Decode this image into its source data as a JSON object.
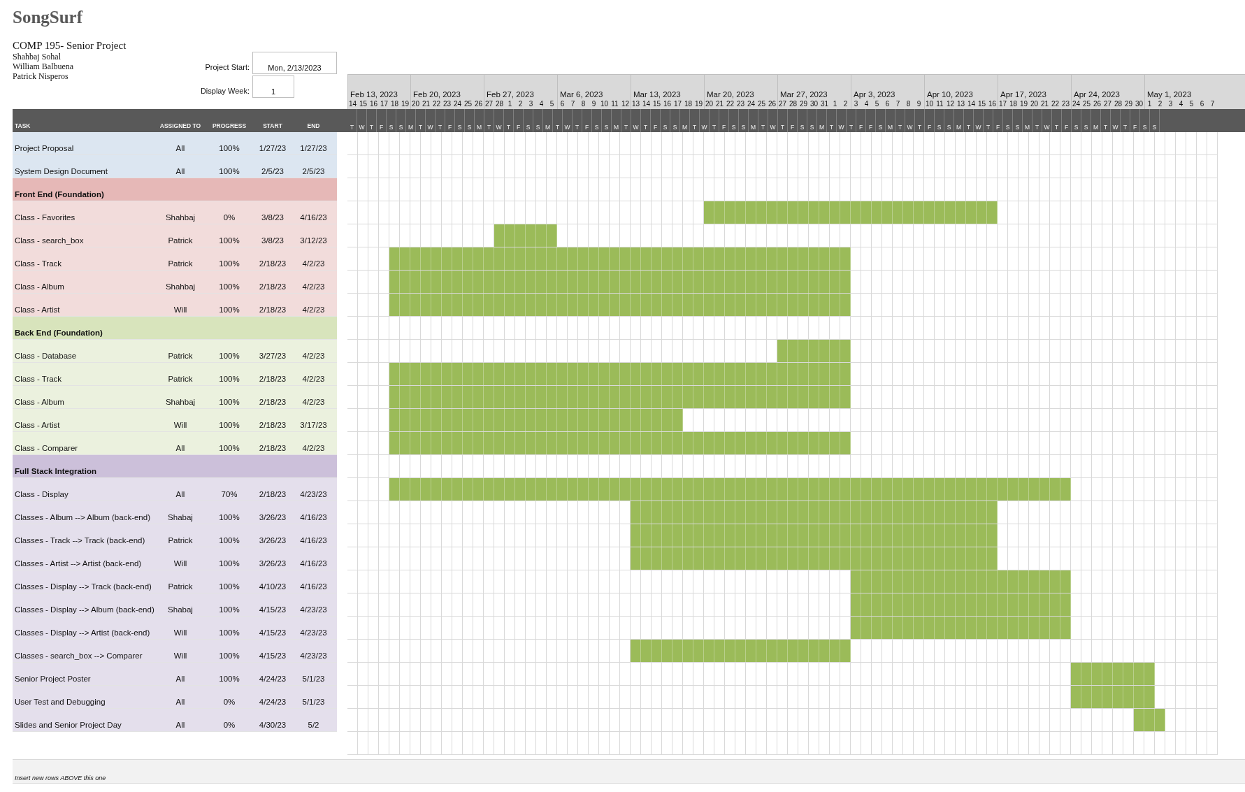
{
  "title": "SongSurf",
  "course": "COMP 195- Senior Project",
  "team": [
    "Shahbaj Sohal",
    "William Balbuena",
    "Patrick Nisperos"
  ],
  "project_start": {
    "label": "Project Start:",
    "value": "Mon, 2/13/2023"
  },
  "display_week": {
    "label": "Display Week:",
    "value": "1"
  },
  "columns": [
    "TASK",
    "ASSIGNED TO",
    "PROGRESS",
    "START",
    "END"
  ],
  "timeline": {
    "weeks": [
      {
        "label": "Feb 13, 2023",
        "days": [
          [
            "14",
            "T"
          ],
          [
            "15",
            "W"
          ],
          [
            "16",
            "T"
          ],
          [
            "17",
            "F"
          ],
          [
            "18",
            "S"
          ],
          [
            "19",
            "S"
          ]
        ]
      },
      {
        "label": "Feb 20, 2023",
        "days": [
          [
            "20",
            "M"
          ],
          [
            "21",
            "T"
          ],
          [
            "22",
            "W"
          ],
          [
            "23",
            "T"
          ],
          [
            "24",
            "F"
          ],
          [
            "25",
            "S"
          ],
          [
            "26",
            "S"
          ]
        ]
      },
      {
        "label": "Feb 27, 2023",
        "days": [
          [
            "27",
            "M"
          ],
          [
            "28",
            "T"
          ],
          [
            "1",
            "W"
          ],
          [
            "2",
            "T"
          ],
          [
            "3",
            "F"
          ],
          [
            "4",
            "S"
          ],
          [
            "5",
            "S"
          ]
        ]
      },
      {
        "label": "Mar 6, 2023",
        "days": [
          [
            "6",
            "M"
          ],
          [
            "7",
            "T"
          ],
          [
            "8",
            "W"
          ],
          [
            "9",
            "T"
          ],
          [
            "10",
            "F"
          ],
          [
            "11",
            "S"
          ],
          [
            "12",
            "S"
          ]
        ]
      },
      {
        "label": "Mar 13, 2023",
        "days": [
          [
            "13",
            "M"
          ],
          [
            "14",
            "T"
          ],
          [
            "15",
            "W"
          ],
          [
            "16",
            "T"
          ],
          [
            "17",
            "F"
          ],
          [
            "18",
            "S"
          ],
          [
            "19",
            "S"
          ]
        ]
      },
      {
        "label": "Mar 20, 2023",
        "days": [
          [
            "20",
            "M"
          ],
          [
            "21",
            "T"
          ],
          [
            "22",
            "W"
          ],
          [
            "23",
            "T"
          ],
          [
            "24",
            "F"
          ],
          [
            "25",
            "S"
          ],
          [
            "26",
            "S"
          ]
        ]
      },
      {
        "label": "Mar 27, 2023",
        "days": [
          [
            "27",
            "M"
          ],
          [
            "28",
            "T"
          ],
          [
            "29",
            "W"
          ],
          [
            "30",
            "T"
          ],
          [
            "31",
            "F"
          ],
          [
            "1",
            "S"
          ],
          [
            "2",
            "S"
          ]
        ]
      },
      {
        "label": "Apr 3, 2023",
        "days": [
          [
            "3",
            "M"
          ],
          [
            "4",
            "T"
          ],
          [
            "5",
            "W"
          ],
          [
            "6",
            "T"
          ],
          [
            "7",
            "F"
          ],
          [
            "8",
            "F"
          ],
          [
            "9",
            "S"
          ]
        ]
      },
      {
        "label": "Apr 10, 2023",
        "days": [
          [
            "10",
            "M"
          ],
          [
            "11",
            "T"
          ],
          [
            "12",
            "W"
          ],
          [
            "13",
            "T"
          ],
          [
            "14",
            "F"
          ],
          [
            "15",
            "S"
          ],
          [
            "16",
            "S"
          ]
        ]
      },
      {
        "label": "Apr 17, 2023",
        "days": [
          [
            "17",
            "M"
          ],
          [
            "18",
            "T"
          ],
          [
            "19",
            "W"
          ],
          [
            "20",
            "T"
          ],
          [
            "21",
            "F"
          ],
          [
            "22",
            "S"
          ],
          [
            "23",
            "S"
          ]
        ]
      },
      {
        "label": "Apr 24, 2023",
        "days": [
          [
            "24",
            "M"
          ],
          [
            "25",
            "T"
          ],
          [
            "26",
            "W"
          ],
          [
            "27",
            "T"
          ],
          [
            "28",
            "F"
          ],
          [
            "29",
            "S"
          ],
          [
            "30",
            "S"
          ]
        ]
      },
      {
        "label": "May 1, 2023",
        "days": [
          [
            "1",
            "M"
          ],
          [
            "2",
            "T"
          ],
          [
            "3",
            "W"
          ],
          [
            "4",
            "T"
          ],
          [
            "5",
            "F"
          ],
          [
            "6",
            "S"
          ],
          [
            "7",
            "S"
          ]
        ]
      }
    ]
  },
  "rows": [
    {
      "kind": "task",
      "color": "#dce6f1",
      "task": "Project Proposal",
      "assigned": "All",
      "progress": "100%",
      "start": "1/27/23",
      "end": "1/27/23"
    },
    {
      "kind": "task",
      "color": "#dce6f1",
      "task": "System Design Document",
      "assigned": "All",
      "progress": "100%",
      "start": "2/5/23",
      "end": "2/5/23"
    },
    {
      "kind": "section",
      "color": "#e6b8b7",
      "task": "Front End (Foundation)"
    },
    {
      "kind": "task",
      "color": "#f2dcdb",
      "task": "Class - Favorites",
      "assigned": "Shahbaj",
      "progress": "0%",
      "start": "3/8/23",
      "end": "4/16/23",
      "cells": [
        false,
        false,
        false,
        false,
        false,
        false,
        false,
        false,
        false,
        false,
        false,
        false,
        false,
        false,
        false,
        false,
        false,
        false,
        false,
        false,
        false,
        false,
        false,
        false,
        false,
        false,
        false,
        false,
        false,
        false,
        false,
        false,
        false,
        false,
        true,
        true,
        true,
        true,
        true,
        true,
        true,
        true,
        true,
        true,
        true,
        true,
        true,
        true,
        true,
        true,
        true,
        true,
        true,
        true,
        true,
        true,
        true,
        true,
        true,
        true,
        true,
        true,
        false,
        false,
        false,
        false,
        false,
        false,
        false,
        false,
        false,
        false,
        false,
        false,
        false,
        false,
        false,
        false,
        false,
        false,
        false,
        false,
        false
      ]
    },
    {
      "kind": "task",
      "color": "#f2dcdb",
      "task": "Class - search_box",
      "assigned": "Patrick",
      "progress": "100%",
      "start": "3/8/23",
      "end": "3/12/23",
      "cells": [
        false,
        false,
        false,
        false,
        false,
        false,
        false,
        false,
        false,
        false,
        false,
        false,
        false,
        false,
        true,
        true,
        true,
        true,
        true,
        true,
        false,
        false,
        false,
        false,
        false,
        false,
        false,
        false,
        false,
        false,
        false,
        false,
        false,
        false,
        false,
        false,
        false,
        false,
        false,
        false,
        false,
        false,
        false,
        false,
        false,
        false,
        false,
        false,
        false,
        false,
        false,
        false,
        false,
        false,
        false,
        false,
        false,
        false,
        false,
        false,
        false,
        false,
        false,
        false,
        false,
        false,
        false,
        false,
        false,
        false,
        false,
        false,
        false,
        false,
        false,
        false,
        false,
        false,
        false,
        false,
        false,
        false,
        false
      ]
    },
    {
      "kind": "task",
      "color": "#f2dcdb",
      "task": "Class - Track",
      "assigned": "Patrick",
      "progress": "100%",
      "start": "2/18/23",
      "end": "4/2/23",
      "cells": [
        false,
        false,
        false,
        false,
        true,
        true,
        true,
        true,
        true,
        true,
        true,
        true,
        true,
        true,
        true,
        true,
        true,
        true,
        true,
        true,
        true,
        true,
        true,
        true,
        true,
        true,
        true,
        true,
        true,
        true,
        true,
        true,
        true,
        true,
        true,
        true,
        true,
        true,
        true,
        true,
        true,
        true,
        true,
        true,
        true,
        true,
        true,
        true,
        false,
        false,
        false,
        false,
        false,
        false,
        false,
        false,
        false,
        false,
        false,
        false,
        false,
        false,
        false,
        false,
        false,
        false,
        false,
        false,
        false,
        false,
        false,
        false,
        false,
        false,
        false,
        false,
        false,
        false,
        false,
        false,
        false,
        false,
        false
      ]
    },
    {
      "kind": "task",
      "color": "#f2dcdb",
      "task": "Class - Album",
      "assigned": "Shahbaj",
      "progress": "100%",
      "start": "2/18/23",
      "end": "4/2/23",
      "cells": [
        false,
        false,
        false,
        false,
        true,
        true,
        true,
        true,
        true,
        true,
        true,
        true,
        true,
        true,
        true,
        true,
        true,
        true,
        true,
        true,
        true,
        true,
        true,
        true,
        true,
        true,
        true,
        true,
        true,
        true,
        true,
        true,
        true,
        true,
        true,
        true,
        true,
        true,
        true,
        true,
        true,
        true,
        true,
        true,
        true,
        true,
        true,
        true,
        false,
        false,
        false,
        false,
        false,
        false,
        false,
        false,
        false,
        false,
        false,
        false,
        false,
        false,
        false,
        false,
        false,
        false,
        false,
        false,
        false,
        false,
        false,
        false,
        false,
        false,
        false,
        false,
        false,
        false,
        false,
        false,
        false,
        false,
        false
      ]
    },
    {
      "kind": "task",
      "color": "#f2dcdb",
      "task": "Class - Artist",
      "assigned": "Will",
      "progress": "100%",
      "start": "2/18/23",
      "end": "4/2/23",
      "cells": [
        false,
        false,
        false,
        false,
        true,
        true,
        true,
        true,
        true,
        true,
        true,
        true,
        true,
        true,
        true,
        true,
        true,
        true,
        true,
        true,
        true,
        true,
        true,
        true,
        true,
        true,
        true,
        true,
        true,
        true,
        true,
        true,
        true,
        true,
        true,
        true,
        true,
        true,
        true,
        true,
        true,
        true,
        true,
        true,
        true,
        true,
        true,
        true,
        false,
        false,
        false,
        false,
        false,
        false,
        false,
        false,
        false,
        false,
        false,
        false,
        false,
        false,
        false,
        false,
        false,
        false,
        false,
        false,
        false,
        false,
        false,
        false,
        false,
        false,
        false,
        false,
        false,
        false,
        false,
        false,
        false,
        false,
        false
      ]
    },
    {
      "kind": "section",
      "color": "#d8e4bc",
      "task": "Back End (Foundation)"
    },
    {
      "kind": "task",
      "color": "#ebf1de",
      "task": "Class - Database",
      "assigned": "Patrick",
      "progress": "100%",
      "start": "3/27/23",
      "end": "4/2/23",
      "cells": [
        false,
        false,
        false,
        false,
        false,
        false,
        false,
        false,
        false,
        false,
        false,
        false,
        false,
        false,
        false,
        false,
        false,
        false,
        false,
        false,
        false,
        false,
        false,
        false,
        false,
        false,
        false,
        false,
        false,
        false,
        false,
        false,
        false,
        false,
        false,
        false,
        false,
        false,
        false,
        false,
        false,
        true,
        true,
        true,
        true,
        true,
        true,
        true,
        false,
        false,
        false,
        false,
        false,
        false,
        false,
        false,
        false,
        false,
        false,
        false,
        false,
        false,
        false,
        false,
        false,
        false,
        false,
        false,
        false,
        false,
        false,
        false,
        false,
        false,
        false,
        false,
        false,
        false,
        false,
        false,
        false,
        false,
        false
      ]
    },
    {
      "kind": "task",
      "color": "#ebf1de",
      "task": "Class - Track",
      "assigned": "Patrick",
      "progress": "100%",
      "start": "2/18/23",
      "end": "4/2/23",
      "cells": [
        false,
        false,
        false,
        false,
        true,
        true,
        true,
        true,
        true,
        true,
        true,
        true,
        true,
        true,
        true,
        true,
        true,
        true,
        true,
        true,
        true,
        true,
        true,
        true,
        true,
        true,
        true,
        true,
        true,
        true,
        true,
        true,
        true,
        true,
        true,
        true,
        true,
        true,
        true,
        true,
        true,
        true,
        true,
        true,
        true,
        true,
        true,
        true,
        false,
        false,
        false,
        false,
        false,
        false,
        false,
        false,
        false,
        false,
        false,
        false,
        false,
        false,
        false,
        false,
        false,
        false,
        false,
        false,
        false,
        false,
        false,
        false,
        false,
        false,
        false,
        false,
        false,
        false,
        false,
        false,
        false,
        false,
        false
      ]
    },
    {
      "kind": "task",
      "color": "#ebf1de",
      "task": "Class - Album",
      "assigned": "Shahbaj",
      "progress": "100%",
      "start": "2/18/23",
      "end": "4/2/23",
      "cells": [
        false,
        false,
        false,
        false,
        true,
        true,
        true,
        true,
        true,
        true,
        true,
        true,
        true,
        true,
        true,
        true,
        true,
        true,
        true,
        true,
        true,
        true,
        true,
        true,
        true,
        true,
        true,
        true,
        true,
        true,
        true,
        true,
        true,
        true,
        true,
        true,
        true,
        true,
        true,
        true,
        true,
        true,
        true,
        true,
        true,
        true,
        true,
        true,
        false,
        false,
        false,
        false,
        false,
        false,
        false,
        false,
        false,
        false,
        false,
        false,
        false,
        false,
        false,
        false,
        false,
        false,
        false,
        false,
        false,
        false,
        false,
        false,
        false,
        false,
        false,
        false,
        false,
        false,
        false,
        false,
        false,
        false,
        false
      ]
    },
    {
      "kind": "task",
      "color": "#ebf1de",
      "task": "Class - Artist",
      "assigned": "Will",
      "progress": "100%",
      "start": "2/18/23",
      "end": "3/17/23",
      "cells": [
        false,
        false,
        false,
        false,
        true,
        true,
        true,
        true,
        true,
        true,
        true,
        true,
        true,
        true,
        true,
        true,
        true,
        true,
        true,
        true,
        true,
        true,
        true,
        true,
        true,
        true,
        true,
        true,
        true,
        true,
        true,
        true,
        false,
        false,
        false,
        false,
        false,
        false,
        false,
        false,
        false,
        false,
        false,
        false,
        false,
        false,
        false,
        false,
        false,
        false,
        false,
        false,
        false,
        false,
        false,
        false,
        false,
        false,
        false,
        false,
        false,
        false,
        false,
        false,
        false,
        false,
        false,
        false,
        false,
        false,
        false,
        false,
        false,
        false,
        false,
        false,
        false,
        false,
        false,
        false,
        false,
        false,
        false
      ]
    },
    {
      "kind": "task",
      "color": "#ebf1de",
      "task": "Class - Comparer",
      "assigned": "All",
      "progress": "100%",
      "start": "2/18/23",
      "end": "4/2/23",
      "cells": [
        false,
        false,
        false,
        false,
        true,
        true,
        true,
        true,
        true,
        true,
        true,
        true,
        true,
        true,
        true,
        true,
        true,
        true,
        true,
        true,
        true,
        true,
        true,
        true,
        true,
        true,
        true,
        true,
        true,
        true,
        true,
        true,
        true,
        true,
        true,
        true,
        true,
        true,
        true,
        true,
        true,
        true,
        true,
        true,
        true,
        true,
        true,
        true,
        false,
        false,
        false,
        false,
        false,
        false,
        false,
        false,
        false,
        false,
        false,
        false,
        false,
        false,
        false,
        false,
        false,
        false,
        false,
        false,
        false,
        false,
        false,
        false,
        false,
        false,
        false,
        false,
        false,
        false,
        false,
        false,
        false,
        false,
        false
      ]
    },
    {
      "kind": "section",
      "color": "#ccc0da",
      "task": "Full Stack Integration"
    },
    {
      "kind": "task",
      "color": "#e4dfec",
      "task": "Class - Display",
      "assigned": "All",
      "progress": "70%",
      "start": "2/18/23",
      "end": "4/23/23",
      "cells": [
        false,
        false,
        false,
        false,
        true,
        true,
        true,
        true,
        true,
        true,
        true,
        true,
        true,
        true,
        true,
        true,
        true,
        true,
        true,
        true,
        true,
        true,
        true,
        true,
        true,
        true,
        true,
        true,
        true,
        true,
        true,
        true,
        true,
        true,
        true,
        true,
        true,
        true,
        true,
        true,
        true,
        true,
        true,
        true,
        true,
        true,
        true,
        true,
        true,
        true,
        true,
        true,
        true,
        true,
        true,
        true,
        true,
        true,
        true,
        true,
        true,
        true,
        true,
        true,
        true,
        true,
        true,
        true,
        true,
        false,
        false,
        false,
        false,
        false,
        false,
        false,
        false,
        false,
        false,
        false,
        false,
        false,
        false
      ]
    },
    {
      "kind": "task",
      "color": "#e4dfec",
      "task": "Classes - Album --> Album (back-end)",
      "assigned": "Shabaj",
      "progress": "100%",
      "start": "3/26/23",
      "end": "4/16/23",
      "cells": [
        false,
        false,
        false,
        false,
        false,
        false,
        false,
        false,
        false,
        false,
        false,
        false,
        false,
        false,
        false,
        false,
        false,
        false,
        false,
        false,
        false,
        false,
        false,
        false,
        false,
        false,
        false,
        true,
        true,
        true,
        true,
        true,
        true,
        true,
        true,
        true,
        true,
        true,
        true,
        true,
        true,
        true,
        true,
        true,
        true,
        true,
        true,
        true,
        true,
        true,
        true,
        true,
        true,
        true,
        true,
        true,
        true,
        true,
        true,
        true,
        true,
        true,
        false,
        false,
        false,
        false,
        false,
        false,
        false,
        false,
        false,
        false,
        false,
        false,
        false,
        false,
        false,
        false,
        false,
        false,
        false,
        false,
        false
      ]
    },
    {
      "kind": "task",
      "color": "#e4dfec",
      "task": "Classes - Track --> Track (back-end)",
      "assigned": "Patrick",
      "progress": "100%",
      "start": "3/26/23",
      "end": "4/16/23",
      "cells": [
        false,
        false,
        false,
        false,
        false,
        false,
        false,
        false,
        false,
        false,
        false,
        false,
        false,
        false,
        false,
        false,
        false,
        false,
        false,
        false,
        false,
        false,
        false,
        false,
        false,
        false,
        false,
        true,
        true,
        true,
        true,
        true,
        true,
        true,
        true,
        true,
        true,
        true,
        true,
        true,
        true,
        true,
        true,
        true,
        true,
        true,
        true,
        true,
        true,
        true,
        true,
        true,
        true,
        true,
        true,
        true,
        true,
        true,
        true,
        true,
        true,
        true,
        false,
        false,
        false,
        false,
        false,
        false,
        false,
        false,
        false,
        false,
        false,
        false,
        false,
        false,
        false,
        false,
        false,
        false,
        false,
        false,
        false
      ]
    },
    {
      "kind": "task",
      "color": "#e4dfec",
      "task": "Classes - Artist --> Artist (back-end)",
      "assigned": "Will",
      "progress": "100%",
      "start": "3/26/23",
      "end": "4/16/23",
      "cells": [
        false,
        false,
        false,
        false,
        false,
        false,
        false,
        false,
        false,
        false,
        false,
        false,
        false,
        false,
        false,
        false,
        false,
        false,
        false,
        false,
        false,
        false,
        false,
        false,
        false,
        false,
        false,
        true,
        true,
        true,
        true,
        true,
        true,
        true,
        true,
        true,
        true,
        true,
        true,
        true,
        true,
        true,
        true,
        true,
        true,
        true,
        true,
        true,
        true,
        true,
        true,
        true,
        true,
        true,
        true,
        true,
        true,
        true,
        true,
        true,
        true,
        true,
        false,
        false,
        false,
        false,
        false,
        false,
        false,
        false,
        false,
        false,
        false,
        false,
        false,
        false,
        false,
        false,
        false,
        false,
        false,
        false,
        false
      ]
    },
    {
      "kind": "task",
      "color": "#e4dfec",
      "task": "Classes - Display --> Track (back-end)",
      "assigned": "Patrick",
      "progress": "100%",
      "start": "4/10/23",
      "end": "4/16/23",
      "cells": [
        false,
        false,
        false,
        false,
        false,
        false,
        false,
        false,
        false,
        false,
        false,
        false,
        false,
        false,
        false,
        false,
        false,
        false,
        false,
        false,
        false,
        false,
        false,
        false,
        false,
        false,
        false,
        false,
        false,
        false,
        false,
        false,
        false,
        false,
        false,
        false,
        false,
        false,
        false,
        false,
        false,
        false,
        false,
        false,
        false,
        false,
        false,
        false,
        true,
        true,
        true,
        true,
        true,
        true,
        true,
        true,
        true,
        true,
        true,
        true,
        true,
        true,
        true,
        true,
        true,
        true,
        true,
        true,
        true,
        false,
        false,
        false,
        false,
        false,
        false,
        false,
        false,
        false,
        false,
        false,
        false,
        false,
        false
      ]
    },
    {
      "kind": "task",
      "color": "#e4dfec",
      "task": "Classes - Display --> Album (back-end)",
      "assigned": "Shabaj",
      "progress": "100%",
      "start": "4/15/23",
      "end": "4/23/23",
      "cells": [
        false,
        false,
        false,
        false,
        false,
        false,
        false,
        false,
        false,
        false,
        false,
        false,
        false,
        false,
        false,
        false,
        false,
        false,
        false,
        false,
        false,
        false,
        false,
        false,
        false,
        false,
        false,
        false,
        false,
        false,
        false,
        false,
        false,
        false,
        false,
        false,
        false,
        false,
        false,
        false,
        false,
        false,
        false,
        false,
        false,
        false,
        false,
        false,
        true,
        true,
        true,
        true,
        true,
        true,
        true,
        true,
        true,
        true,
        true,
        true,
        true,
        true,
        true,
        true,
        true,
        true,
        true,
        true,
        true,
        false,
        false,
        false,
        false,
        false,
        false,
        false,
        false,
        false,
        false,
        false,
        false,
        false,
        false
      ]
    },
    {
      "kind": "task",
      "color": "#e4dfec",
      "task": "Classes - Display --> Artist (back-end)",
      "assigned": "Will",
      "progress": "100%",
      "start": "4/15/23",
      "end": "4/23/23",
      "cells": [
        false,
        false,
        false,
        false,
        false,
        false,
        false,
        false,
        false,
        false,
        false,
        false,
        false,
        false,
        false,
        false,
        false,
        false,
        false,
        false,
        false,
        false,
        false,
        false,
        false,
        false,
        false,
        false,
        false,
        false,
        false,
        false,
        false,
        false,
        false,
        false,
        false,
        false,
        false,
        false,
        false,
        false,
        false,
        false,
        false,
        false,
        false,
        false,
        true,
        true,
        true,
        true,
        true,
        true,
        true,
        true,
        true,
        true,
        true,
        true,
        true,
        true,
        true,
        true,
        true,
        true,
        true,
        true,
        true,
        false,
        false,
        false,
        false,
        false,
        false,
        false,
        false,
        false,
        false,
        false,
        false,
        false,
        false
      ]
    },
    {
      "kind": "task",
      "color": "#e4dfec",
      "task": "Classes - search_box --> Comparer",
      "assigned": "Will",
      "progress": "100%",
      "start": "4/15/23",
      "end": "4/23/23",
      "cells": [
        false,
        false,
        false,
        false,
        false,
        false,
        false,
        false,
        false,
        false,
        false,
        false,
        false,
        false,
        false,
        false,
        false,
        false,
        false,
        false,
        false,
        false,
        false,
        false,
        false,
        false,
        false,
        true,
        true,
        true,
        true,
        true,
        true,
        true,
        true,
        true,
        true,
        true,
        true,
        true,
        true,
        true,
        true,
        true,
        true,
        true,
        true,
        true,
        false,
        false,
        false,
        false,
        false,
        false,
        false,
        false,
        false,
        false,
        false,
        false,
        false,
        false,
        false,
        false,
        false,
        false,
        false,
        false,
        false,
        false,
        false,
        false,
        false,
        false,
        false,
        false,
        false,
        false,
        false,
        false,
        false,
        false,
        false
      ]
    },
    {
      "kind": "task",
      "color": "#e4dfec",
      "task": "Senior Project Poster",
      "assigned": "All",
      "progress": "100%",
      "start": "4/24/23",
      "end": "5/1/23",
      "cells": [
        false,
        false,
        false,
        false,
        false,
        false,
        false,
        false,
        false,
        false,
        false,
        false,
        false,
        false,
        false,
        false,
        false,
        false,
        false,
        false,
        false,
        false,
        false,
        false,
        false,
        false,
        false,
        false,
        false,
        false,
        false,
        false,
        false,
        false,
        false,
        false,
        false,
        false,
        false,
        false,
        false,
        false,
        false,
        false,
        false,
        false,
        false,
        false,
        false,
        false,
        false,
        false,
        false,
        false,
        false,
        false,
        false,
        false,
        false,
        false,
        false,
        false,
        false,
        false,
        false,
        false,
        false,
        false,
        false,
        true,
        true,
        true,
        true,
        true,
        true,
        true,
        true,
        false,
        false,
        false,
        false,
        false,
        false
      ]
    },
    {
      "kind": "task",
      "color": "#e4dfec",
      "task": "User Test and Debugging",
      "assigned": "All",
      "progress": "0%",
      "start": "4/24/23",
      "end": "5/1/23",
      "cells": [
        false,
        false,
        false,
        false,
        false,
        false,
        false,
        false,
        false,
        false,
        false,
        false,
        false,
        false,
        false,
        false,
        false,
        false,
        false,
        false,
        false,
        false,
        false,
        false,
        false,
        false,
        false,
        false,
        false,
        false,
        false,
        false,
        false,
        false,
        false,
        false,
        false,
        false,
        false,
        false,
        false,
        false,
        false,
        false,
        false,
        false,
        false,
        false,
        false,
        false,
        false,
        false,
        false,
        false,
        false,
        false,
        false,
        false,
        false,
        false,
        false,
        false,
        false,
        false,
        false,
        false,
        false,
        false,
        false,
        true,
        true,
        true,
        true,
        true,
        true,
        true,
        true,
        false,
        false,
        false,
        false,
        false,
        false
      ]
    },
    {
      "kind": "task",
      "color": "#e4dfec",
      "task": "Slides and Senior Project Day",
      "assigned": "All",
      "progress": "0%",
      "start": "4/30/23",
      "end": "5/2",
      "cells": [
        false,
        false,
        false,
        false,
        false,
        false,
        false,
        false,
        false,
        false,
        false,
        false,
        false,
        false,
        false,
        false,
        false,
        false,
        false,
        false,
        false,
        false,
        false,
        false,
        false,
        false,
        false,
        false,
        false,
        false,
        false,
        false,
        false,
        false,
        false,
        false,
        false,
        false,
        false,
        false,
        false,
        false,
        false,
        false,
        false,
        false,
        false,
        false,
        false,
        false,
        false,
        false,
        false,
        false,
        false,
        false,
        false,
        false,
        false,
        false,
        false,
        false,
        false,
        false,
        false,
        false,
        false,
        false,
        false,
        false,
        false,
        false,
        false,
        false,
        false,
        true,
        true,
        true,
        false,
        false,
        false,
        false,
        false
      ]
    }
  ],
  "footer_note": "Insert new rows ABOVE this one"
}
